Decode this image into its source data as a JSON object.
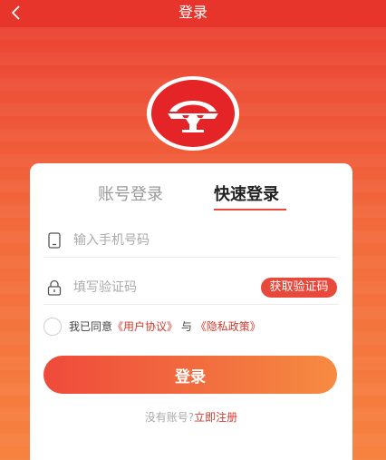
{
  "header": {
    "title": "登录",
    "back_icon": "chevron-left-icon"
  },
  "logo": {
    "icon": "brand-logo"
  },
  "tabs": [
    {
      "label": "账号登录",
      "active": false
    },
    {
      "label": "快速登录",
      "active": true
    }
  ],
  "form": {
    "phone": {
      "placeholder": "输入手机号码",
      "value": "",
      "icon": "phone-icon"
    },
    "code": {
      "placeholder": "填写验证码",
      "value": "",
      "icon": "lock-icon"
    },
    "get_code_label": "获取验证码"
  },
  "agreement": {
    "checked": false,
    "prefix": "我已同意",
    "user_agreement": "《用户协议》",
    "conjunction": "与",
    "privacy_policy": "《隐私政策》"
  },
  "login_button": "登录",
  "register": {
    "prompt": "没有账号?",
    "link": "立即注册"
  },
  "colors": {
    "accent": "#e8493b",
    "header": "#e8352c",
    "link": "#d23a2f"
  }
}
